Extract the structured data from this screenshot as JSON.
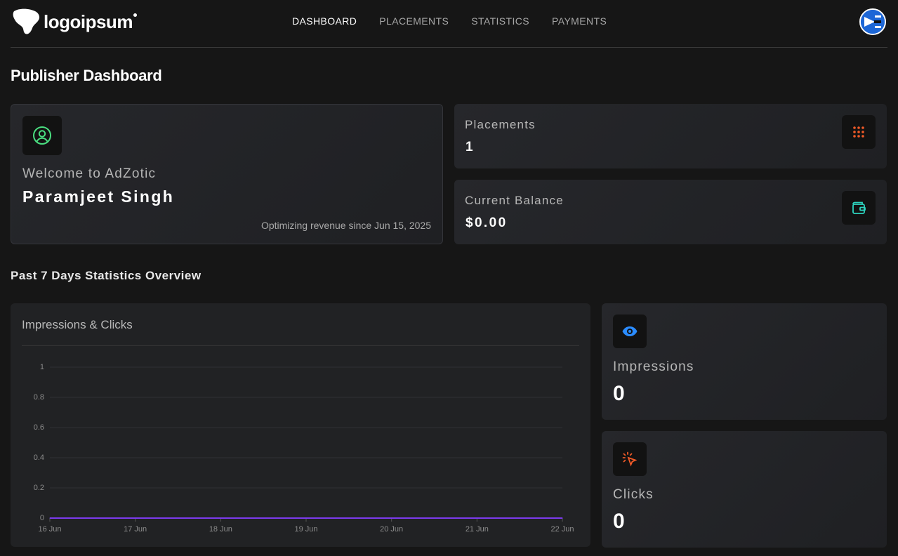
{
  "header": {
    "logo_text": "logoipsum",
    "nav": [
      {
        "label": "DASHBOARD",
        "active": true
      },
      {
        "label": "PLACEMENTS",
        "active": false
      },
      {
        "label": "STATISTICS",
        "active": false
      },
      {
        "label": "PAYMENTS",
        "active": false
      }
    ],
    "avatar_icon": "user-avatar-icon"
  },
  "page": {
    "title": "Publisher Dashboard"
  },
  "welcome": {
    "icon": "user-circle-icon",
    "label": "Welcome to AdZotic",
    "name": "Paramjeet Singh",
    "since": "Optimizing revenue since Jun 15, 2025",
    "icon_color": "#4ade80"
  },
  "placements": {
    "label": "Placements",
    "value": "1",
    "icon": "grid-dots-icon",
    "icon_color": "#f05a28"
  },
  "balance": {
    "label": "Current Balance",
    "value": "$0.00",
    "icon": "wallet-icon",
    "icon_color": "#2dd4bf"
  },
  "stats": {
    "section_title": "Past 7 Days Statistics Overview",
    "chart_title": "Impressions & Clicks"
  },
  "impressions": {
    "label": "Impressions",
    "value": "0",
    "icon": "eye-icon",
    "icon_color": "#2b8cff"
  },
  "clicks": {
    "label": "Clicks",
    "value": "0",
    "icon": "cursor-click-icon",
    "icon_color": "#f05a28"
  },
  "chart_data": {
    "type": "line",
    "title": "Impressions & Clicks",
    "xlabel": "",
    "ylabel": "",
    "x": [
      "16 Jun",
      "17 Jun",
      "18 Jun",
      "19 Jun",
      "20 Jun",
      "21 Jun",
      "22 Jun"
    ],
    "series": [
      {
        "values": [
          0,
          0,
          0,
          0,
          0,
          0,
          0
        ],
        "color": "#7c3aed"
      },
      {
        "values": [
          0,
          0,
          0,
          0,
          0,
          0,
          0
        ],
        "color": "#2563eb"
      }
    ],
    "yticks": [
      0,
      0.2,
      0.4,
      0.6,
      0.8,
      1
    ],
    "ytick_labels": [
      "0",
      "0.2",
      "0.4",
      "0.6",
      "0.8",
      "1"
    ],
    "ylim": [
      0,
      1
    ],
    "grid": true,
    "legend": "none"
  }
}
